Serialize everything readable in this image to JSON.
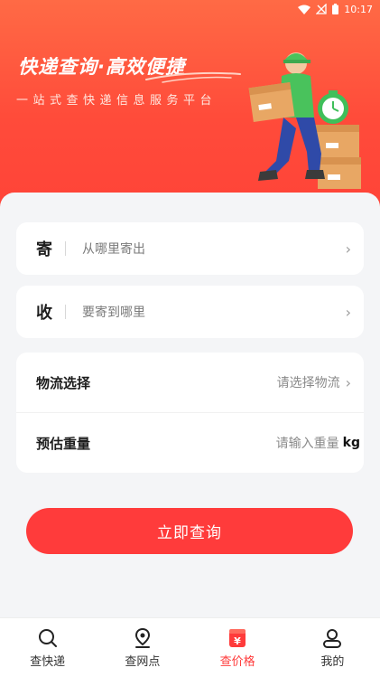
{
  "status": {
    "time": "10:17"
  },
  "hero": {
    "title": "快递查询·高效便捷",
    "subtitle": "一站式查快递信息服务平台"
  },
  "send": {
    "tag": "寄",
    "placeholder": "从哪里寄出"
  },
  "receive": {
    "tag": "收",
    "placeholder": "要寄到哪里"
  },
  "logistics": {
    "label": "物流选择",
    "value": "请选择物流"
  },
  "weight": {
    "label": "预估重量",
    "placeholder": "请输入重量",
    "unit": "kg"
  },
  "query_button": "立即查询",
  "tabs": [
    {
      "label": "查快递",
      "icon": "search-icon",
      "active": false
    },
    {
      "label": "查网点",
      "icon": "location-pin-icon",
      "active": false
    },
    {
      "label": "查价格",
      "icon": "price-tag-icon",
      "active": true
    },
    {
      "label": "我的",
      "icon": "user-icon",
      "active": false
    }
  ],
  "colors": {
    "accent": "#ff3b3b",
    "hero_top": "#ff6a45"
  }
}
